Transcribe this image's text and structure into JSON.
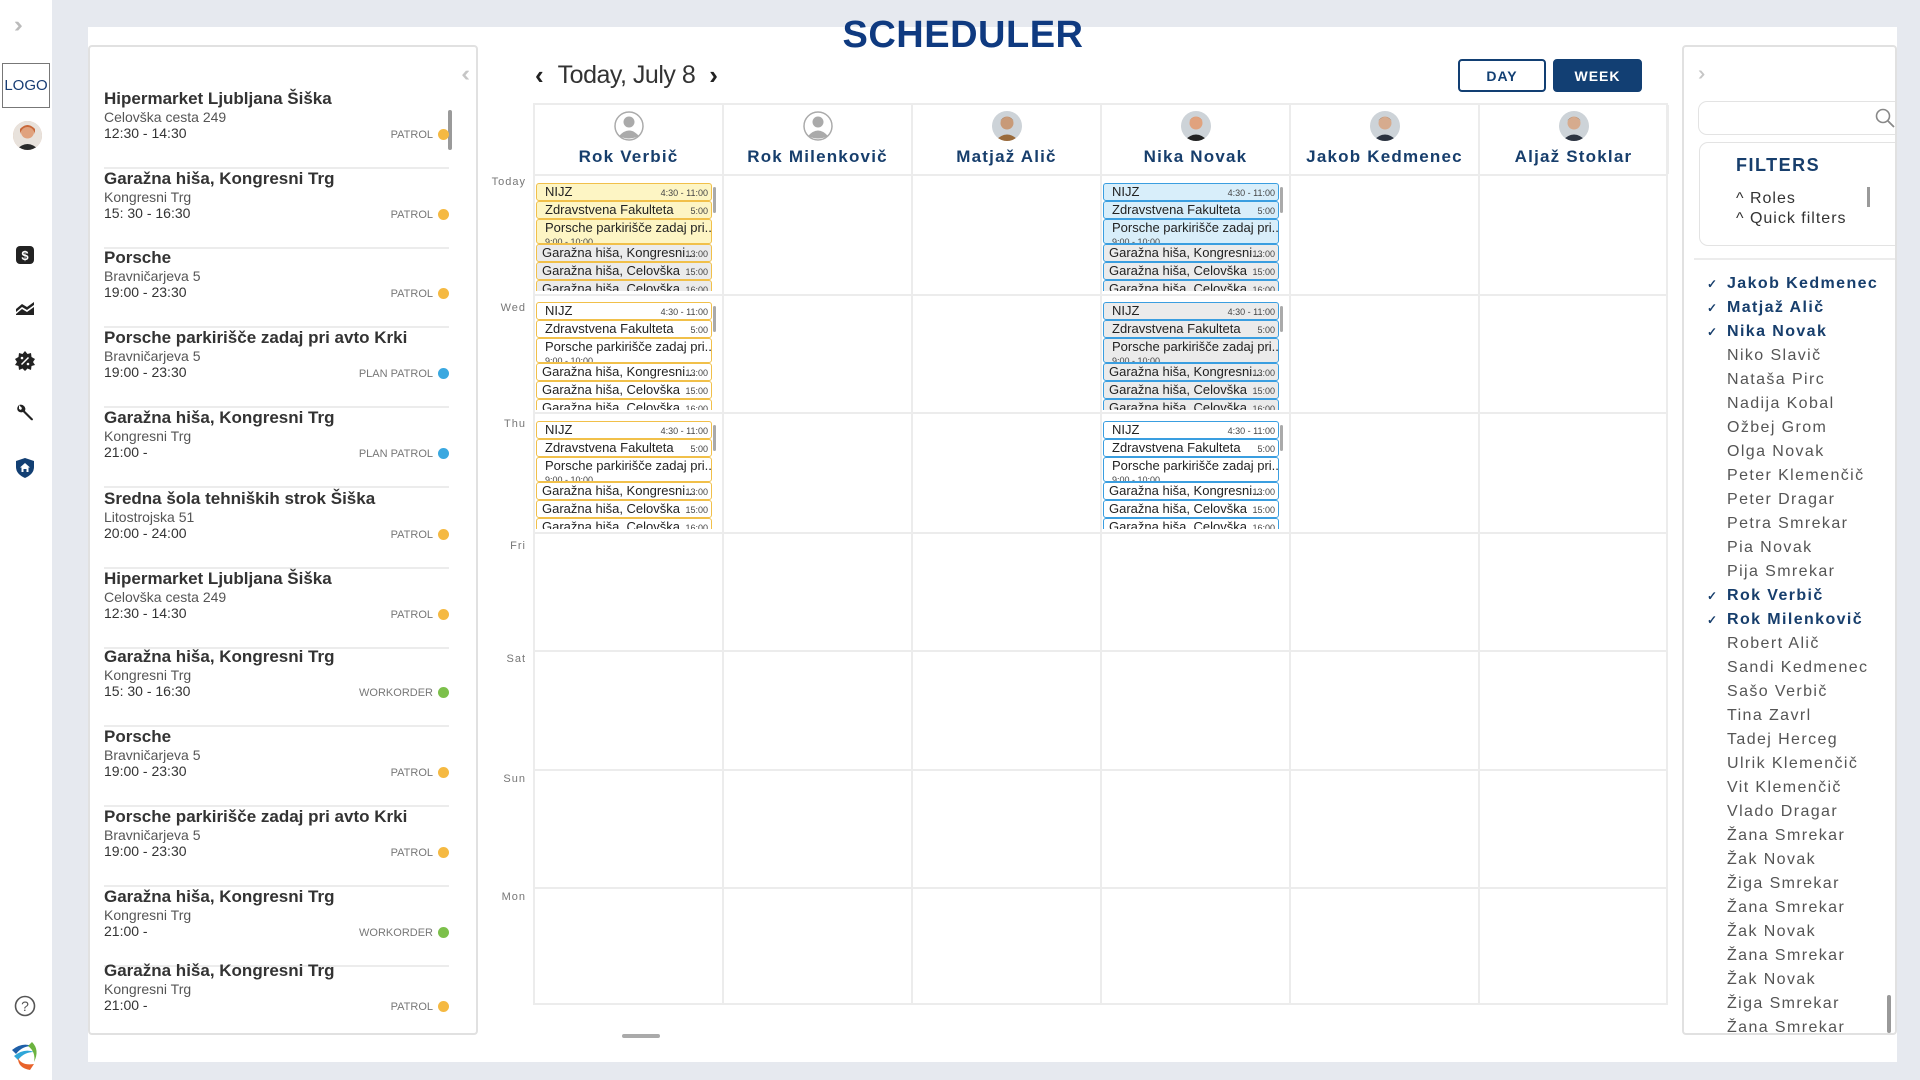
{
  "app": {
    "title": "SCHEDULER"
  },
  "rail": {
    "logo_text": "LOGO",
    "icons": [
      "expand-icon",
      "dollar-icon",
      "chart-icon",
      "discount-badge-icon",
      "wrench-icon",
      "shield-home-icon",
      "help-icon",
      "brand-logo-icon"
    ]
  },
  "jobs": [
    {
      "name": "Hipermarket Ljubljana Šiška",
      "address": "Celovška cesta 249",
      "time": "12:30 - 14:30",
      "type": "PATROL",
      "color": "#f5b942"
    },
    {
      "name": "Garažna hiša, Kongresni Trg",
      "address": "Kongresni Trg",
      "time": "15: 30 - 16:30",
      "type": "PATROL",
      "color": "#f5b942"
    },
    {
      "name": "Porsche",
      "address": "Bravničarjeva 5",
      "time": "19:00 - 23:30",
      "type": "PATROL",
      "color": "#f5b942"
    },
    {
      "name": "Porsche parkirišče zadaj pri avto Krki",
      "address": "Bravničarjeva 5",
      "time": "19:00 - 23:30",
      "type": "PLAN PATROL",
      "color": "#3aa8e0"
    },
    {
      "name": "Garažna hiša, Kongresni Trg",
      "address": "Kongresni Trg",
      "time": "21:00 -",
      "type": "PLAN PATROL",
      "color": "#3aa8e0"
    },
    {
      "name": "Sredna šola tehniških strok Šiška",
      "address": "Litostrojska 51",
      "time": "20:00 - 24:00",
      "type": "PATROL",
      "color": "#f5b942"
    },
    {
      "name": "Hipermarket Ljubljana Šiška",
      "address": "Celovška cesta 249",
      "time": "12:30 - 14:30",
      "type": "PATROL",
      "color": "#f5b942"
    },
    {
      "name": "Garažna hiša, Kongresni Trg",
      "address": "Kongresni Trg",
      "time": "15: 30 - 16:30",
      "type": "WORKORDER",
      "color": "#7cc04b"
    },
    {
      "name": "Porsche",
      "address": "Bravničarjeva 5",
      "time": "19:00 - 23:30",
      "type": "PATROL",
      "color": "#f5b942"
    },
    {
      "name": "Porsche parkirišče zadaj pri avto Krki",
      "address": "Bravničarjeva 5",
      "time": "19:00 - 23:30",
      "type": "PATROL",
      "color": "#f5b942"
    },
    {
      "name": "Garažna hiša, Kongresni Trg",
      "address": "Kongresni Trg",
      "time": "21:00 -",
      "type": "WORKORDER",
      "color": "#7cc04b"
    },
    {
      "name": "Garažna hiša, Kongresni Trg",
      "address": "Kongresni Trg",
      "time": "21:00 -",
      "type": "PATROL",
      "color": "#f5b942"
    }
  ],
  "datenav": {
    "prev": "‹",
    "label": "Today, July 8",
    "next": "›"
  },
  "view": {
    "day": "DAY",
    "week": "WEEK",
    "active": "WEEK"
  },
  "columns": [
    {
      "name": "Rok Verbič",
      "avatar": "placeholder"
    },
    {
      "name": "Rok Milenkovič",
      "avatar": "placeholder"
    },
    {
      "name": "Matjaž Alič",
      "avatar": "photo"
    },
    {
      "name": "Nika Novak",
      "avatar": "photo"
    },
    {
      "name": "Jakob Kedmenec",
      "avatar": "photo"
    },
    {
      "name": "Aljaž Stoklar",
      "avatar": "photo"
    }
  ],
  "days": [
    "Today",
    "Wed",
    "Thu",
    "Fri",
    "Sat",
    "Sun",
    "Mon"
  ],
  "event_template": [
    {
      "title": "NIJZ",
      "time": "4:30 - 11:00",
      "kind": "primary"
    },
    {
      "title": "Zdravstvena Fakulteta",
      "time": "5:00",
      "kind": "primary"
    },
    {
      "title": "Porsche parkirišče zadaj pri...",
      "subtime": "9:00 - 10:00",
      "kind": "primary"
    },
    {
      "title": "Garažna hiša, Kongresni...",
      "time": "13:00",
      "kind": "secondary"
    },
    {
      "title": "Garažna hiša, Celovška",
      "time": "15:00",
      "kind": "secondary"
    },
    {
      "title": "Garažna hiša, Celovška",
      "time": "16:00",
      "kind": "secondary"
    }
  ],
  "event_blocks": [
    {
      "column": 0,
      "day": 0,
      "border": "#f1c04a",
      "primary_fill": "#fdf5c4",
      "secondary_fill": "#ebebeb"
    },
    {
      "column": 0,
      "day": 1,
      "border": "#f1c04a",
      "primary_fill": "#ffffff",
      "secondary_fill": "#ffffff"
    },
    {
      "column": 0,
      "day": 2,
      "border": "#f1c04a",
      "primary_fill": "#ffffff",
      "secondary_fill": "#ffffff"
    },
    {
      "column": 3,
      "day": 0,
      "border": "#3a9ee0",
      "primary_fill": "#d8eefa",
      "secondary_fill": "#ebebeb"
    },
    {
      "column": 3,
      "day": 1,
      "border": "#3a9ee0",
      "primary_fill": "#ebebeb",
      "secondary_fill": "#ebebeb"
    },
    {
      "column": 3,
      "day": 2,
      "border": "#3a9ee0",
      "primary_fill": "#ffffff",
      "secondary_fill": "#ffffff"
    }
  ],
  "filters": {
    "search_placeholder": "",
    "title": "FILTERS",
    "options": [
      "^ Roles",
      "^ Quick filters"
    ]
  },
  "employees": [
    {
      "name": "Jakob Kedmenec",
      "selected": true
    },
    {
      "name": "Matjaž Alič",
      "selected": true
    },
    {
      "name": "Nika Novak",
      "selected": true
    },
    {
      "name": "Niko Slavič",
      "selected": false
    },
    {
      "name": "Nataša Pirc",
      "selected": false
    },
    {
      "name": "Nadija Kobal",
      "selected": false
    },
    {
      "name": "Ožbej Grom",
      "selected": false
    },
    {
      "name": "Olga Novak",
      "selected": false
    },
    {
      "name": "Peter Klemenčič",
      "selected": false
    },
    {
      "name": "Peter Dragar",
      "selected": false
    },
    {
      "name": "Petra Smrekar",
      "selected": false
    },
    {
      "name": "Pia Novak",
      "selected": false
    },
    {
      "name": "Pija Smrekar",
      "selected": false
    },
    {
      "name": "Rok Verbič",
      "selected": true
    },
    {
      "name": "Rok Milenkovič",
      "selected": true
    },
    {
      "name": "Robert Alič",
      "selected": false
    },
    {
      "name": "Sandi Kedmenec",
      "selected": false
    },
    {
      "name": "Sašo Verbič",
      "selected": false
    },
    {
      "name": "Tina Zavrl",
      "selected": false
    },
    {
      "name": "Tadej Herceg",
      "selected": false
    },
    {
      "name": "Ulrik Klemenčič",
      "selected": false
    },
    {
      "name": "Vit Klemenčič",
      "selected": false
    },
    {
      "name": "Vlado Dragar",
      "selected": false
    },
    {
      "name": "Žana Smrekar",
      "selected": false
    },
    {
      "name": "Žak Novak",
      "selected": false
    },
    {
      "name": "Žiga Smrekar",
      "selected": false
    },
    {
      "name": "Žana Smrekar",
      "selected": false
    },
    {
      "name": "Žak Novak",
      "selected": false
    },
    {
      "name": "Žana Smrekar",
      "selected": false
    },
    {
      "name": "Žak Novak",
      "selected": false
    },
    {
      "name": "Žiga Smrekar",
      "selected": false
    },
    {
      "name": "Žana Smrekar",
      "selected": false
    }
  ]
}
